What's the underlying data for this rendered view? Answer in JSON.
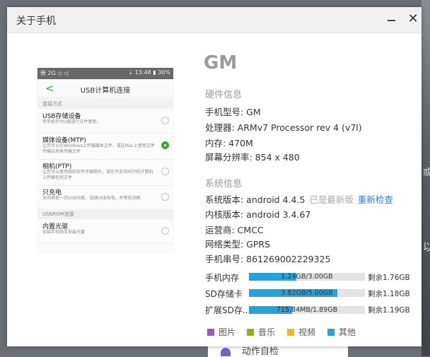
{
  "background": {
    "right_text": "或",
    "right_text2": "以",
    "bottom_item": "动作自检"
  },
  "dialog": {
    "title": "关于手机",
    "close_glyph": "✕"
  },
  "phone_preview": {
    "status_left": "卌 2G ◇ ◁",
    "status_right": "⇣ 13:48 ▮ 30%",
    "back_glyph": "<",
    "title": "USB计算机连接",
    "section_mode": "连接方式",
    "items": [
      {
        "title": "USB存储设备",
        "desc": "将手机作为U盘进行文件复制。",
        "selected": false
      },
      {
        "title": "媒体设备(MTP)",
        "desc": "让您可以在Windows上传输媒体文件，或在Mac上使用文件传输应用来传输文件",
        "selected": true
      },
      {
        "title": "相机(PTP)",
        "desc": "让您可以使用相机软件传输照片，或在不支持MTP的计算机上传输任何文件",
        "selected": false
      },
      {
        "title": "只充电",
        "desc": "关闭其他一切USB功能，加速USB充电，并降低功耗",
        "selected": false
      }
    ],
    "section_rom": "USBROM连接",
    "rom_item": {
      "title": "内置光驱",
      "desc": "安装手机助手安装光盘",
      "selected": false
    }
  },
  "brand": "GM",
  "hardware": {
    "heading": "硬件信息",
    "model": "手机型号: GM",
    "cpu": "处理器: ARMv7 Processor rev 4 (v7l)",
    "ram": "内存: 470M",
    "resolution": "屏幕分辨率: 854 x 480"
  },
  "system": {
    "heading": "系统信息",
    "version_label": "系统版本: android 4.4.5",
    "version_status": "已是最新版",
    "check_link": "重新检查",
    "kernel": "内核版本: android 3.4.67",
    "carrier": "运营商: CMCC",
    "network": "网络类型: GPRS",
    "imei": "手机串号: 861269002229325"
  },
  "storage": [
    {
      "label": "手机内存",
      "usage": "1.24GB/3.00GB",
      "fraction": 0.41,
      "free": "剩余1.76GB"
    },
    {
      "label": "SD存储卡",
      "usage": "3.82GB/5.00GB",
      "fraction": 0.76,
      "free": "剩余1.18GB"
    },
    {
      "label": "扩展SD存...",
      "usage": "715.84MB/1.89GB",
      "fraction": 0.37,
      "free": "剩余1.19GB"
    }
  ],
  "legend": [
    {
      "label": "图片",
      "color": "#9b59b6"
    },
    {
      "label": "音乐",
      "color": "#8fb024"
    },
    {
      "label": "视频",
      "color": "#f1b823"
    },
    {
      "label": "其他",
      "color": "#2aa0d8"
    }
  ],
  "colors": {
    "accent": "#2aa0d8",
    "link": "#2b7cd3",
    "phone_green": "#3aa64a"
  }
}
